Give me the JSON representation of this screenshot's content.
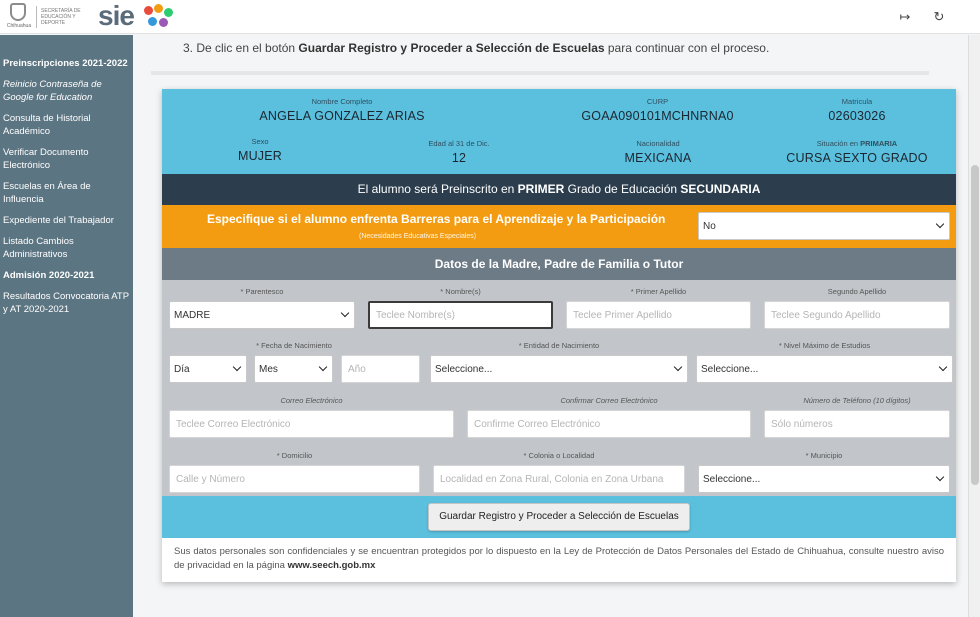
{
  "header": {
    "gov_logo_text": "Chihuahua",
    "secretaria_text": "SECRETARÍA DE EDUCACIÓN Y DEPORTE",
    "app_logo": "sie",
    "icons": [
      "exit-icon",
      "refresh-icon"
    ]
  },
  "sidebar": {
    "items": [
      {
        "label": "Preinscripciones 2021-2022",
        "style": "heading"
      },
      {
        "label": "Reinicio Contraseña de Google for Education",
        "style": "italic"
      },
      {
        "label": "Consulta de Historial Académico",
        "style": "normal"
      },
      {
        "label": "Verificar Documento Electrónico",
        "style": "normal"
      },
      {
        "label": "Escuelas en Área de Influencia",
        "style": "normal"
      },
      {
        "label": "Expediente del Trabajador",
        "style": "normal"
      },
      {
        "label": "Listado Cambios Administrativos",
        "style": "normal"
      },
      {
        "label": "Admisión 2020-2021",
        "style": "heading"
      },
      {
        "label": "Resultados Convocatoria ATP y AT 2020-2021",
        "style": "normal"
      }
    ]
  },
  "instruction": {
    "prefix": "3. De clic en el botón ",
    "bold": "Guardar Registro y Proceder a Selección de Escuelas",
    "suffix": " para continuar con el proceso."
  },
  "student": {
    "nombre_label": "Nombre Completo",
    "nombre": "ANGELA GONZALEZ ARIAS",
    "curp_label": "CURP",
    "curp": "GOAA090101MCHNRNA0",
    "matricula_label": "Matricula",
    "matricula": "02603026",
    "sexo_label": "Sexo",
    "sexo": "MUJER",
    "edad_label": "Edad al 31 de Dic.",
    "edad": "12",
    "nacionalidad_label": "Nacionalidad",
    "nacionalidad": "MEXICANA",
    "situacion_label": "Situación en ",
    "situacion_label_bold": "PRIMARIA",
    "situacion": "CURSA SEXTO GRADO"
  },
  "grade_banner": {
    "p1": "El alumno será Preinscrito en ",
    "b1": "PRIMER",
    "p2": " Grado de Educación ",
    "b2": "SECUNDARIA"
  },
  "barriers": {
    "title": "Especifique si el alumno enfrenta Barreras para el Aprendizaje y la Participación",
    "subtitle": "(Necesidades Educativas Especiales)",
    "value": "No"
  },
  "parent": {
    "heading": "Datos de la Madre, Padre de Familia o Tutor",
    "parentesco_label": "* Parentesco",
    "parentesco_value": "MADRE",
    "nombre_label": "* Nombre(s)",
    "nombre_placeholder": "Teclee Nombre(s)",
    "apellido1_label": "* Primer Apellido",
    "apellido1_placeholder": "Teclee Primer Apellido",
    "apellido2_label": "Segundo Apellido",
    "apellido2_placeholder": "Teclee Segundo Apellido",
    "nacimiento_label": "* Fecha de Nacimiento",
    "dia_value": "Día",
    "mes_value": "Mes",
    "anio_placeholder": "Año",
    "entidad_label": "* Entidad de Nacimiento",
    "entidad_value": "Seleccione...",
    "estudios_label": "* Nivel Máximo de Estudios",
    "estudios_value": "Seleccione...",
    "correo_label": "Correo Electrónico",
    "correo_placeholder": "Teclee Correo Electrónico",
    "confirmar_label": "Confirmar Correo Electrónico",
    "confirmar_placeholder": "Confirme Correo Electrónico",
    "telefono_label": "Número de Teléfono (10 dígitos)",
    "telefono_placeholder": "Sólo números",
    "domicilio_label": "* Domicilio",
    "domicilio_placeholder": "Calle y Número",
    "colonia_label": "* Colonia o Localidad",
    "colonia_placeholder": "Localidad en Zona Rural, Colonia en Zona Urbana",
    "municipio_label": "* Municipio",
    "municipio_value": "Seleccione..."
  },
  "actions": {
    "save_label": "Guardar Registro y Proceder a Selección de Escuelas"
  },
  "privacy": {
    "text": "Sus datos personales son confidenciales y se encuentran protegidos por lo dispuesto en la Ley de Protección de Datos Personales del Estado de Chihuahua, consulte nuestro aviso de privacidad en la página ",
    "link": "www.seech.gob.mx"
  },
  "colors": {
    "sidebar": "#5c7582",
    "cyan": "#5bc0de",
    "dark": "#2c3e4e",
    "orange": "#f39c12",
    "slate": "#6d7b87"
  }
}
